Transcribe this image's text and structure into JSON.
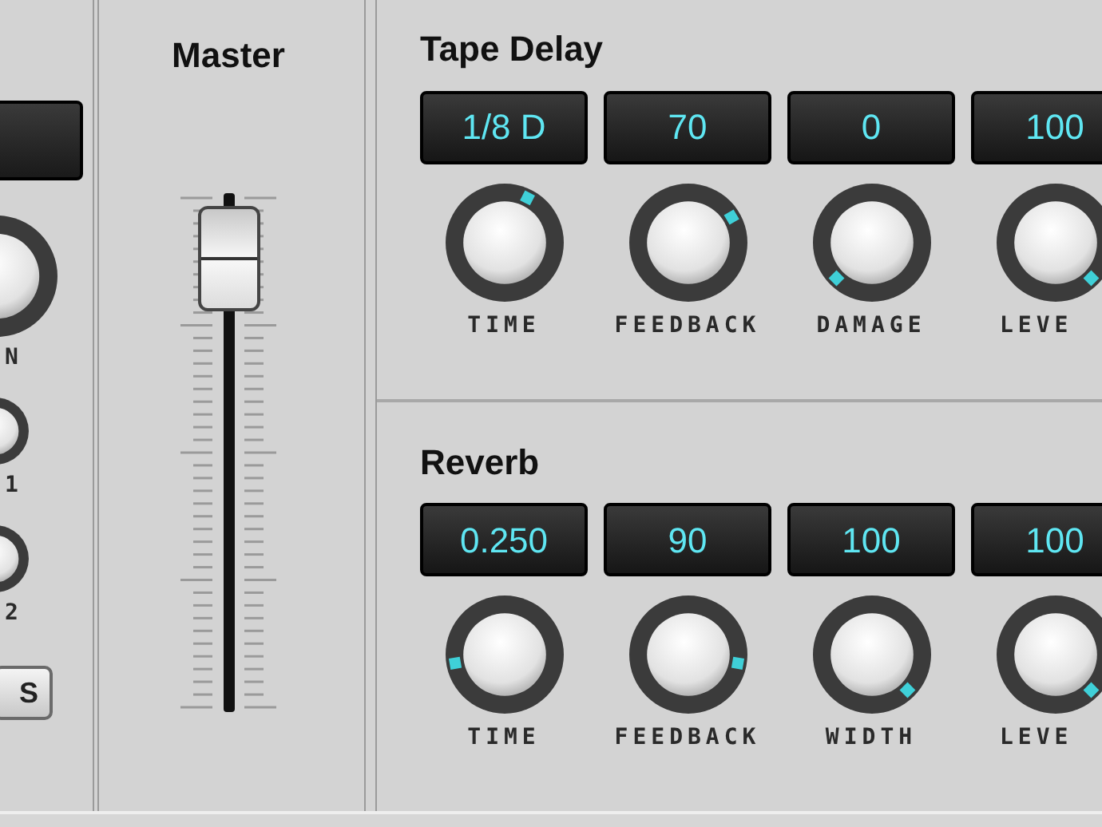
{
  "left_strip": {
    "knobs": [
      {
        "label": "N",
        "kind": "large"
      },
      {
        "label": "1",
        "kind": "small"
      },
      {
        "label": "2",
        "kind": "small"
      }
    ],
    "solo_button": "S"
  },
  "master": {
    "title": "Master"
  },
  "sections": [
    {
      "title": "Tape Delay",
      "controls": [
        {
          "value": "1/8 D",
          "label": "TIME"
        },
        {
          "value": "70",
          "label": "FEEDBACK"
        },
        {
          "value": "0",
          "label": "DAMAGE"
        },
        {
          "value": "100",
          "label": "LEVE"
        }
      ]
    },
    {
      "title": "Reverb",
      "controls": [
        {
          "value": "0.250",
          "label": "TIME"
        },
        {
          "value": "90",
          "label": "FEEDBACK"
        },
        {
          "value": "100",
          "label": "WIDTH"
        },
        {
          "value": "100",
          "label": "LEVE"
        }
      ]
    }
  ]
}
